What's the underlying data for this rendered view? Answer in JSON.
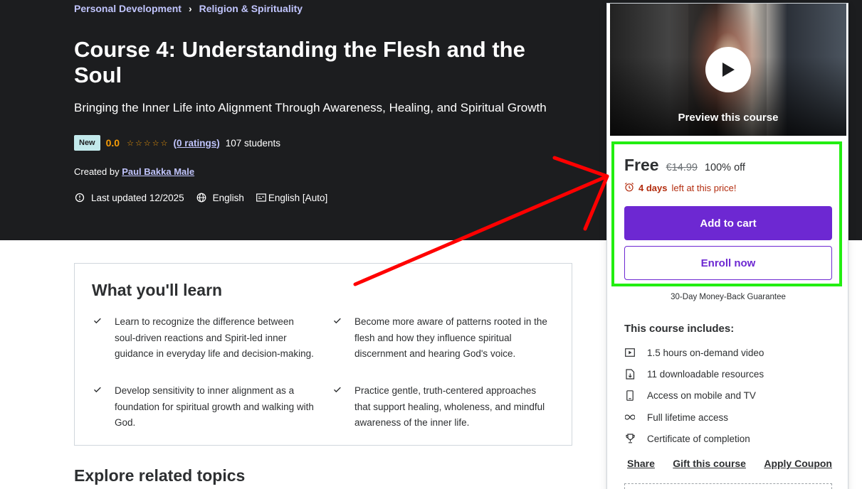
{
  "breadcrumb": [
    "Personal Development",
    "Religion & Spirituality"
  ],
  "course": {
    "title": "Course 4: Understanding the Flesh and the Soul",
    "subtitle": "Bringing the Inner Life into Alignment Through Awareness, Healing, and Spiritual Growth",
    "badge": "New",
    "rating": "0.0",
    "ratings_count": "(0 ratings)",
    "students": "107 students",
    "created_by_label": "Created by",
    "author": "Paul Bakka Male",
    "last_updated": "Last updated 12/2025",
    "language": "English",
    "captions": "English [Auto]"
  },
  "learn": {
    "title": "What you'll learn",
    "items": [
      "Learn to recognize the difference between soul-driven reactions and Spirit-led inner guidance in everyday life and decision-making.",
      "Become more aware of patterns rooted in the flesh and how they influence spiritual discernment and hearing God's voice.",
      "Develop sensitivity to inner alignment as a foundation for spiritual growth and walking with God.",
      "Practice gentle, truth-centered approaches that support healing, wholeness, and mindful awareness of the inner life."
    ]
  },
  "related": {
    "title": "Explore related topics"
  },
  "sidebar": {
    "preview_label": "Preview this course",
    "price": "Free",
    "original_price": "€14.99",
    "discount": "100% off",
    "timer_bold": "4 days",
    "timer_rest": "left at this price!",
    "add_to_cart": "Add to cart",
    "enroll_now": "Enroll now",
    "guarantee": "30-Day Money-Back Guarantee",
    "includes_title": "This course includes:",
    "includes": [
      {
        "icon": "video-icon",
        "label": "1.5 hours on-demand video"
      },
      {
        "icon": "file-download-icon",
        "label": "11 downloadable resources"
      },
      {
        "icon": "mobile-icon",
        "label": "Access on mobile and TV"
      },
      {
        "icon": "infinity-icon",
        "label": "Full lifetime access"
      },
      {
        "icon": "trophy-icon",
        "label": "Certificate of completion"
      }
    ],
    "share": "Share",
    "gift": "Gift this course",
    "coupon": "Apply Coupon"
  },
  "colors": {
    "hero_bg": "#1c1d1f",
    "link_purple": "#c0c4fc",
    "rating_orange": "#f69c08",
    "cta_purple": "#6d28d2",
    "timer_red": "#b32d0f",
    "highlight_green": "#22ee11",
    "annotation_red": "#ff0000"
  }
}
